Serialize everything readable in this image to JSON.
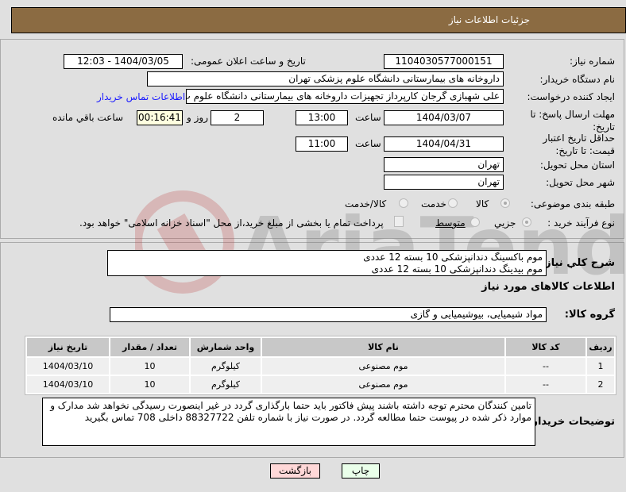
{
  "header": {
    "title": "جزئیات اطلاعات نیاز"
  },
  "fields": {
    "need_number_label": "شماره نیاز:",
    "need_number": "1104030577000151",
    "announce_label": "تاریخ و ساعت اعلان عمومی:",
    "announce_value": "1404/03/05 - 12:03",
    "buyer_org_label": "نام دستگاه خریدار:",
    "buyer_org": "داروخانه های بیمارستانی دانشگاه علوم پزشکی تهران",
    "creator_label": "ایجاد کننده درخواست:",
    "creator": "علی شهبازی گرجان کارپرداز تجهیزات داروخانه های بیمارستانی دانشگاه علوم پ",
    "contact_link": "اطلاعات تماس خریدار",
    "deadline_label": "مهلت ارسال پاسخ: تا تاریخ:",
    "deadline_date": "1404/03/07",
    "time_label": "ساعت",
    "deadline_time": "13:00",
    "days": "2",
    "days_label": "روز و",
    "remaining": "00:16:41",
    "remaining_label": "ساعت باقي مانده",
    "validity_label": "حداقل تاریخ اعتبار قیمت: تا تاریخ:",
    "validity_date": "1404/04/31",
    "validity_time": "11:00",
    "province_label": "استان محل تحویل:",
    "province": "تهران",
    "city_label": "شهر محل تحویل:",
    "city": "تهران",
    "category_label": "طبقه بندی موضوعی:",
    "category_options": [
      "کالا",
      "خدمت",
      "کالا/خدمت"
    ],
    "process_label": "نوع فرآیند خرید :",
    "process_options": [
      "جزیي",
      "متوسط"
    ],
    "payment_note": "پرداخت تمام یا بخشی از مبلغ خرید،از محل \"اسناد خزانه اسلامی\" خواهد بود."
  },
  "description": {
    "label": "شرح کلي نیاز:",
    "lines": [
      "موم باکسینگ دندانپزشکی 10 بسته 12 عددی",
      "موم بیدینگ دندانپزشکی 10 بسته 12 عددی"
    ]
  },
  "goods": {
    "title": "اطلاعات کالاهای مورد نیاز",
    "group_label": "گروه کالا:",
    "group": "مواد شیمیایی، بیوشیمیایی و  گازی",
    "columns": [
      "ردیف",
      "کد کالا",
      "نام کالا",
      "واحد شمارش",
      "تعداد / مقدار",
      "تاریخ نیاز"
    ],
    "rows": [
      [
        "1",
        "--",
        "موم مصنوعی",
        "کیلوگرم",
        "10",
        "1404/03/10"
      ],
      [
        "2",
        "--",
        "موم مصنوعی",
        "کیلوگرم",
        "10",
        "1404/03/10"
      ]
    ]
  },
  "notes": {
    "label": "توضیحات خریدار:",
    "text": "تامین کنندگان محترم توجه داشته باشند پیش فاکتور باید حتما بارگذاری گردد در غیر اینصورت رسیدگی نخواهد شد مدارک و موارد ذکر شده در پیوست حتما مطالعه گردد. در صورت نیاز با شماره تلفن 88327722 داخلی 708 تماس بگیرید"
  },
  "buttons": {
    "print": "چاپ",
    "back": "بازگشت"
  },
  "watermark": "AriaTender.neT"
}
